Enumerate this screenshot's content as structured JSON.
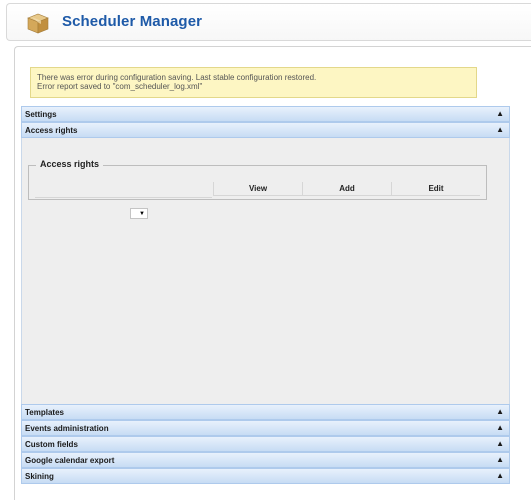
{
  "app": {
    "title": "Scheduler Manager",
    "icon": "package-box-icon"
  },
  "error": {
    "line1": "There was error during configuration saving. Last stable configuration restored.",
    "line2": "Error report saved to \"com_scheduler_log.xml\""
  },
  "panels": {
    "settings": "Settings",
    "access_rights": "Access rights",
    "templates": "Templates",
    "events_administration": "Events administration",
    "custom_fields": "Custom fields",
    "google_calendar_export": "Google calendar export",
    "skining": "Skining"
  },
  "access_rights": {
    "legend": "Access rights",
    "columns": [
      "View",
      "Add",
      "Edit"
    ],
    "group_select_value": ""
  },
  "icons": {
    "collapse": "chevron-up-icon",
    "dropdown": "caret-down-icon"
  },
  "colors": {
    "title": "#1e5aa8",
    "panel_header": "#c7dcf4",
    "error_background": "#fdf6c3",
    "content_background": "#eeeeee"
  }
}
